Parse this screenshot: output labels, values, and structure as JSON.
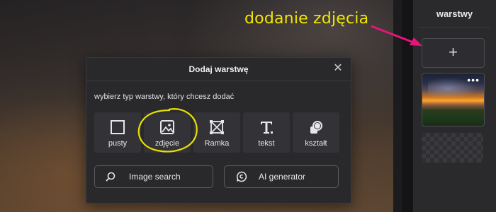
{
  "annotation": {
    "text": "dodanie zdjęcia"
  },
  "layers_panel": {
    "title": "warstwy",
    "add_label": "+",
    "layer_menu": "•••"
  },
  "modal": {
    "title": "Dodaj warstwę",
    "close": "✕",
    "subtitle": "wybierz typ warstwy, który chcesz dodać",
    "types": [
      {
        "label": "pusty",
        "icon": "square-icon"
      },
      {
        "label": "zdjęcie",
        "icon": "image-icon"
      },
      {
        "label": "Ramka",
        "icon": "frame-icon"
      },
      {
        "label": "tekst",
        "icon": "text-icon"
      },
      {
        "label": "kształt",
        "icon": "shape-icon"
      }
    ],
    "image_search": {
      "label": "Image search",
      "icon": "search-icon"
    },
    "ai_generator": {
      "label": "AI generator",
      "icon": "ai-icon"
    }
  },
  "colors": {
    "annotation": "#f2e600",
    "arrow": "#e5157a",
    "circle": "#e8e000",
    "panel_bg": "#2a2a2d",
    "modal_bg": "#29292c"
  }
}
